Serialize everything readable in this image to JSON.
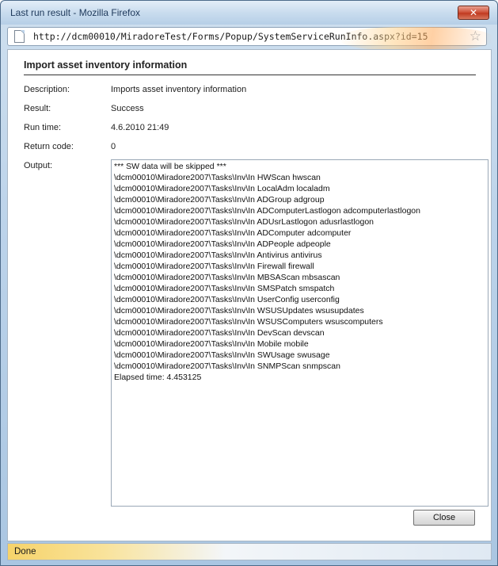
{
  "window": {
    "title": "Last run result - Mozilla Firefox",
    "close_glyph": "✕"
  },
  "addressbar": {
    "url": "http://dcm00010/MiradoreTest/Forms/Popup/SystemServiceRunInfo.aspx?id=15",
    "page_icon": "page-icon",
    "bookmark_icon": "star-icon"
  },
  "content": {
    "heading": "Import asset inventory information",
    "fields": [
      {
        "label": "Description:",
        "value": "Imports asset inventory information"
      },
      {
        "label": "Result:",
        "value": "Success"
      },
      {
        "label": "Run time:",
        "value": "4.6.2010 21:49"
      },
      {
        "label": "Return code:",
        "value": "0"
      }
    ],
    "output_label": "Output:",
    "output_lines": [
      "*** SW data will be skipped ***",
      "\\dcm00010\\Miradore2007\\Tasks\\Inv\\In HWScan hwscan",
      "\\dcm00010\\Miradore2007\\Tasks\\Inv\\In LocalAdm localadm",
      "\\dcm00010\\Miradore2007\\Tasks\\Inv\\In ADGroup adgroup",
      "\\dcm00010\\Miradore2007\\Tasks\\Inv\\In ADComputerLastlogon adcomputerlastlogon",
      "\\dcm00010\\Miradore2007\\Tasks\\Inv\\In ADUsrLastlogon adusrlastlogon",
      "\\dcm00010\\Miradore2007\\Tasks\\Inv\\In ADComputer adcomputer",
      "\\dcm00010\\Miradore2007\\Tasks\\Inv\\In ADPeople adpeople",
      "\\dcm00010\\Miradore2007\\Tasks\\Inv\\In Antivirus antivirus",
      "\\dcm00010\\Miradore2007\\Tasks\\Inv\\In Firewall firewall",
      "\\dcm00010\\Miradore2007\\Tasks\\Inv\\In MBSAScan mbsascan",
      "\\dcm00010\\Miradore2007\\Tasks\\Inv\\In SMSPatch smspatch",
      "\\dcm00010\\Miradore2007\\Tasks\\Inv\\In UserConfig userconfig",
      "\\dcm00010\\Miradore2007\\Tasks\\Inv\\In WSUSUpdates wsusupdates",
      "\\dcm00010\\Miradore2007\\Tasks\\Inv\\In WSUSComputers wsuscomputers",
      "\\dcm00010\\Miradore2007\\Tasks\\Inv\\In DevScan devscan",
      "\\dcm00010\\Miradore2007\\Tasks\\Inv\\In Mobile mobile",
      "\\dcm00010\\Miradore2007\\Tasks\\Inv\\In SWUsage swusage",
      "\\dcm00010\\Miradore2007\\Tasks\\Inv\\In SNMPScan snmpscan",
      "Elapsed time: 4.453125"
    ],
    "close_label": "Close"
  },
  "statusbar": {
    "text": "Done"
  }
}
